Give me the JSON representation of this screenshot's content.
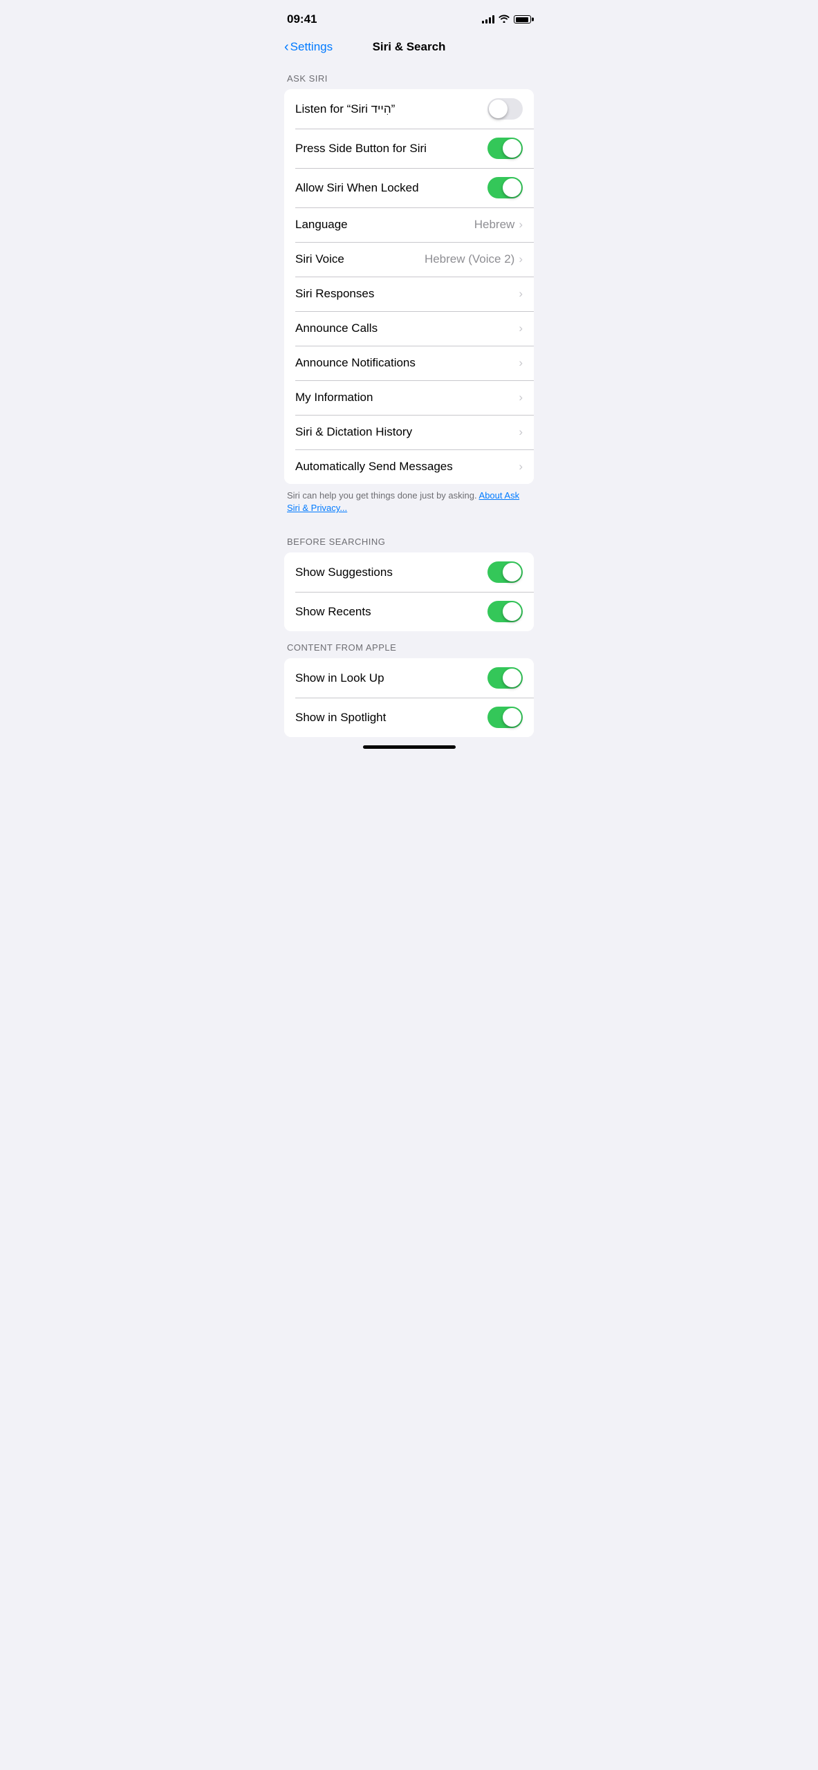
{
  "statusBar": {
    "time": "09:41"
  },
  "navBar": {
    "backLabel": "Settings",
    "title": "Siri & Search"
  },
  "sections": {
    "askSiri": {
      "header": "ASK SIRI",
      "rows": [
        {
          "id": "listen-siri",
          "label": "Listen for “Siri הִייד”",
          "type": "toggle",
          "toggleOn": false
        },
        {
          "id": "press-side",
          "label": "Press Side Button for Siri",
          "type": "toggle",
          "toggleOn": true
        },
        {
          "id": "allow-locked",
          "label": "Allow Siri When Locked",
          "type": "toggle",
          "toggleOn": true
        },
        {
          "id": "language",
          "label": "Language",
          "type": "value-chevron",
          "value": "Hebrew"
        },
        {
          "id": "siri-voice",
          "label": "Siri Voice",
          "type": "value-chevron",
          "value": "Hebrew (Voice 2)"
        },
        {
          "id": "siri-responses",
          "label": "Siri Responses",
          "type": "chevron"
        },
        {
          "id": "announce-calls",
          "label": "Announce Calls",
          "type": "chevron"
        },
        {
          "id": "announce-notifications",
          "label": "Announce Notifications",
          "type": "chevron"
        },
        {
          "id": "my-information",
          "label": "My Information",
          "type": "chevron"
        },
        {
          "id": "siri-dictation-history",
          "label": "Siri & Dictation History",
          "type": "chevron"
        },
        {
          "id": "auto-send-messages",
          "label": "Automatically Send Messages",
          "type": "chevron"
        }
      ],
      "footer": "Siri can help you get things done just by asking.",
      "footerLink": "About Ask Siri & Privacy..."
    },
    "beforeSearching": {
      "header": "BEFORE SEARCHING",
      "rows": [
        {
          "id": "show-suggestions",
          "label": "Show Suggestions",
          "type": "toggle",
          "toggleOn": true
        },
        {
          "id": "show-recents",
          "label": "Show Recents",
          "type": "toggle",
          "toggleOn": true
        }
      ]
    },
    "contentFromApple": {
      "header": "CONTENT FROM APPLE",
      "rows": [
        {
          "id": "show-in-look-up",
          "label": "Show in Look Up",
          "type": "toggle",
          "toggleOn": true
        },
        {
          "id": "show-in-spotlight",
          "label": "Show in Spotlight",
          "type": "toggle",
          "toggleOn": true
        }
      ]
    }
  }
}
